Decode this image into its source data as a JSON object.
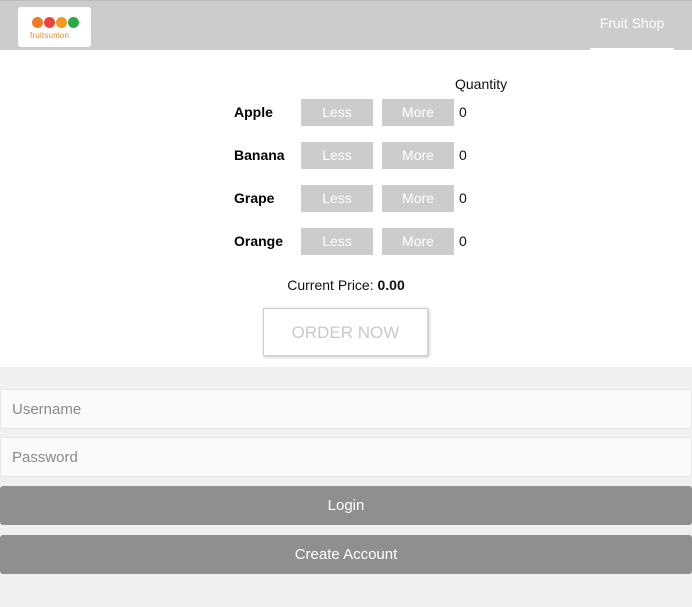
{
  "header": {
    "logo_text": "fruitsunion",
    "logo_dot_colors": [
      "#f07a2a",
      "#e8463c",
      "#f29a1e",
      "#2aa84a"
    ],
    "nav_label": "Fruit Shop"
  },
  "shop": {
    "quantity_header": "Quantity",
    "fruits": [
      {
        "name": "Apple",
        "less": "Less",
        "more": "More",
        "qty": "0"
      },
      {
        "name": "Banana",
        "less": "Less",
        "more": "More",
        "qty": "0"
      },
      {
        "name": "Grape",
        "less": "Less",
        "more": "More",
        "qty": "0"
      },
      {
        "name": "Orange",
        "less": "Less",
        "more": "More",
        "qty": "0"
      }
    ],
    "price_label": "Current Price:",
    "price_value": "0.00",
    "order_label": "ORDER NOW"
  },
  "auth": {
    "username_placeholder": "Username",
    "password_placeholder": "Password",
    "login_label": "Login",
    "create_label": "Create Account"
  }
}
